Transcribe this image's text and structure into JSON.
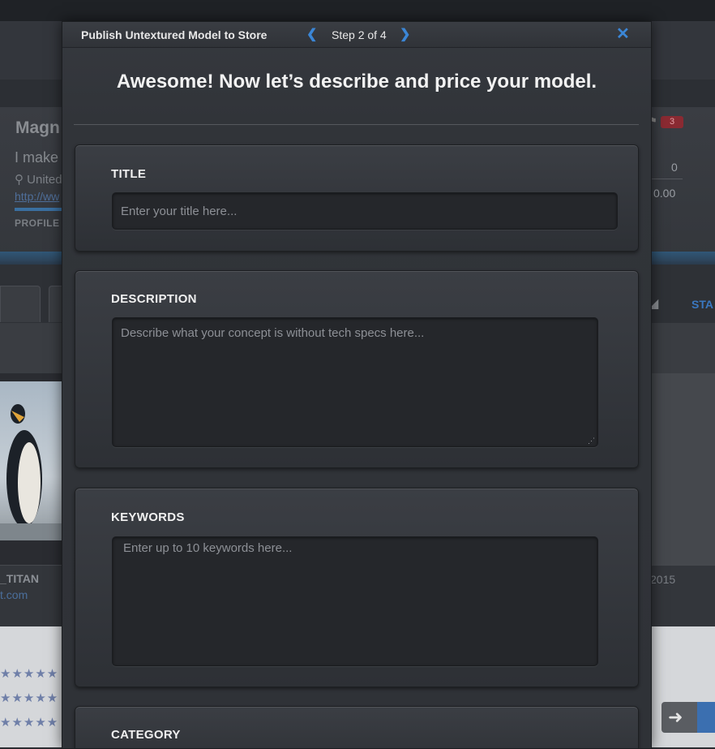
{
  "background": {
    "profile_name": "Magn",
    "profile_bio": "I make",
    "profile_location": "United",
    "profile_link": "http://ww",
    "profile_label": "PROFILE C",
    "badge_count": "3",
    "stat_followers": "0",
    "stat_earnings": "0.00",
    "tab_stats": "STA",
    "username": "_TITAN",
    "user_site": "t.com",
    "year": "2015"
  },
  "modal": {
    "title": "Publish Untextured Model to Store",
    "step_label": "Step 2 of 4",
    "headline": "Awesome! Now let’s describe and price your model."
  },
  "form": {
    "title": {
      "label": "TITLE",
      "placeholder": "Enter your title here..."
    },
    "description": {
      "label": "DESCRIPTION",
      "placeholder": "Describe what your concept is without tech specs here..."
    },
    "keywords": {
      "label": "KEYWORDS",
      "placeholder": "Enter up to 10 keywords here..."
    },
    "category": {
      "label": "CATEGORY"
    }
  },
  "icons": {
    "prev": "chevron-left-icon",
    "next": "chevron-right-icon",
    "close": "close-icon",
    "location": "map-pin-icon",
    "flag": "flag-icon",
    "chart": "chart-icon",
    "arrow": "arrow-right-icon"
  },
  "colors": {
    "accent": "#3b86d6",
    "badge": "#8a2a32",
    "modal_bg": "#313439"
  }
}
